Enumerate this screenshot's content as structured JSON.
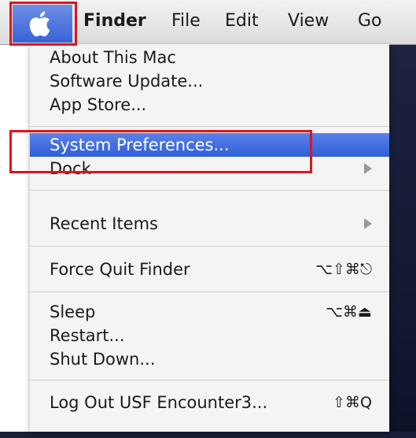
{
  "menubar": {
    "apple_icon": "apple-icon",
    "items": [
      "Finder",
      "File",
      "Edit",
      "View",
      "Go"
    ]
  },
  "apple_menu": {
    "group1": [
      "About This Mac",
      "Software Update...",
      "App Store..."
    ],
    "system_preferences": "System Preferences...",
    "dock": "Dock",
    "recent_items": "Recent Items",
    "force_quit": {
      "label": "Force Quit Finder",
      "shortcut": "⌥⇧⌘⎋"
    },
    "sleep": {
      "label": "Sleep",
      "shortcut": "⌥⌘⏏"
    },
    "restart": "Restart...",
    "shut_down": "Shut Down...",
    "log_out": {
      "label": "Log Out USF Encounter3...",
      "shortcut": "⇧⌘Q"
    }
  },
  "colors": {
    "highlight": "#3a62d6",
    "annotation": "#e0141a",
    "menu_background": "#f4f4f4"
  }
}
